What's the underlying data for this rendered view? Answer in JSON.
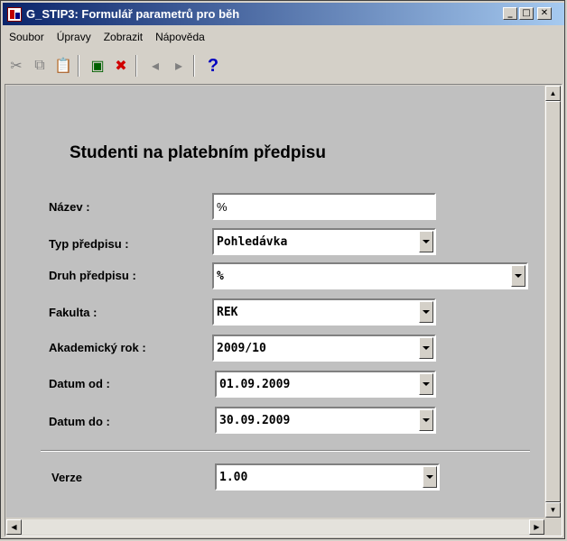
{
  "window": {
    "title": "G_STIP3: Formulář parametrů pro běh"
  },
  "window_controls": {
    "minimize": "_",
    "maximize": "□",
    "close": "✕"
  },
  "menu": [
    "Soubor",
    "Úpravy",
    "Zobrazit",
    "Nápověda"
  ],
  "toolbar": {
    "cut": "✂",
    "copy": "⧉",
    "paste": "📋",
    "run": "▣",
    "delete": "✖",
    "prev": "◂",
    "next": "▸",
    "help": "?"
  },
  "form": {
    "title": "Studenti na platebním předpisu",
    "fields": [
      {
        "label": "Název :",
        "value": "%"
      },
      {
        "label": "Typ předpisu :",
        "value": "Pohledávka"
      },
      {
        "label": "Druh předpisu :",
        "value": "%"
      },
      {
        "label": "Fakulta :",
        "value": "REK"
      },
      {
        "label": "Akademický rok :",
        "value": "2009/10"
      },
      {
        "label": "Datum od :",
        "value": "01.09.2009"
      },
      {
        "label": "Datum do :",
        "value": "30.09.2009"
      },
      {
        "label": "Verze",
        "value": "1.00"
      }
    ]
  },
  "colors": {
    "title_start": "#0a246a",
    "title_end": "#a6caf0",
    "canvas": "#c0c0c0"
  }
}
